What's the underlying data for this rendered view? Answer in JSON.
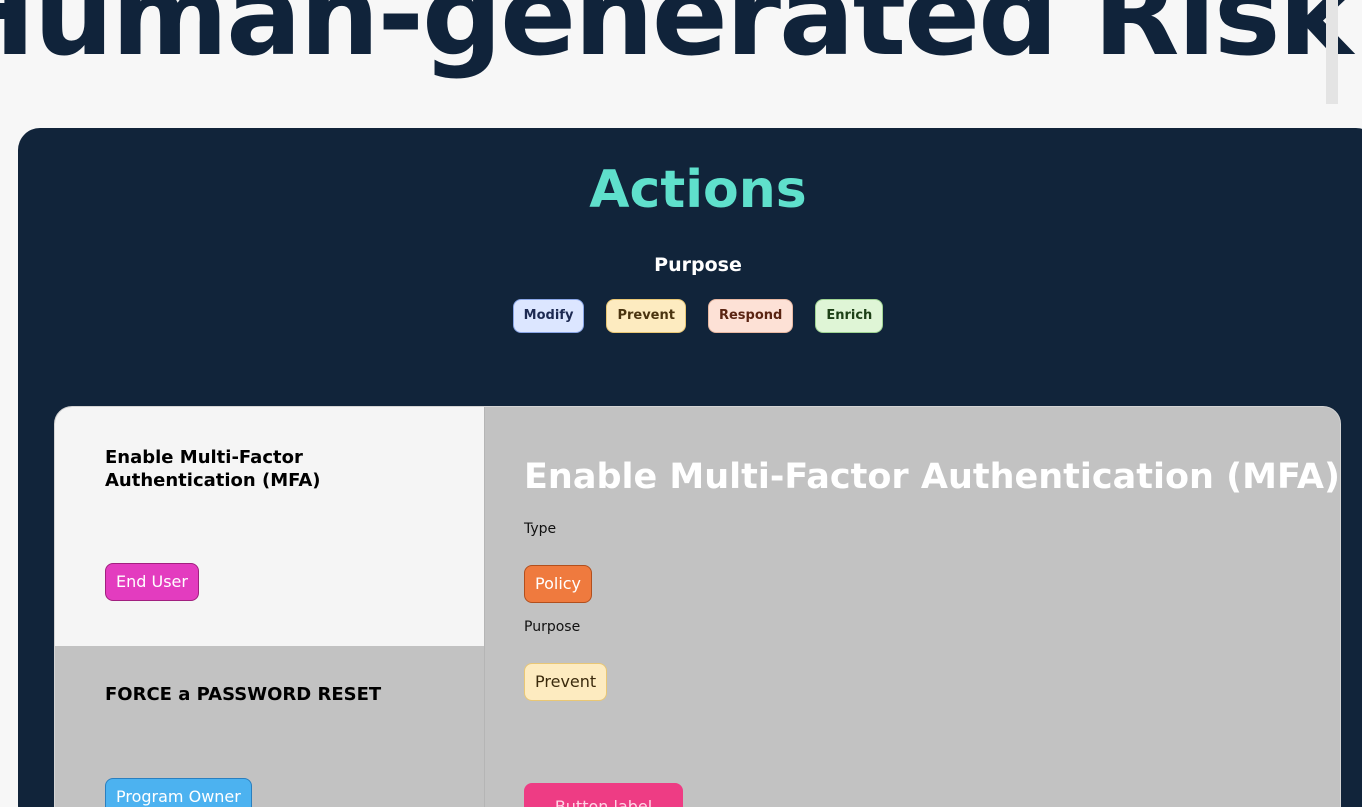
{
  "hero": {
    "text": "Human-generated Risk"
  },
  "section": {
    "title": "Actions",
    "purpose_heading": "Purpose"
  },
  "legend": [
    {
      "label": "Modify",
      "color": "#dce6ff"
    },
    {
      "label": "Prevent",
      "color": "#fdebc0"
    },
    {
      "label": "Respond",
      "color": "#fde1d6"
    },
    {
      "label": "Enrich",
      "color": "#dff5d6"
    }
  ],
  "list": [
    {
      "title": "Enable Multi-Factor Authentication (MFA)",
      "role": "End User",
      "role_color": "#e33cbf"
    },
    {
      "title": "FORCE a PASSWORD RESET",
      "role": "Program Owner",
      "role_color": "#4cb2f0"
    }
  ],
  "detail": {
    "title": "Enable Multi-Factor Authentication (MFA)",
    "type_label": "Type",
    "type_value": "Policy",
    "purpose_label": "Purpose",
    "purpose_value": "Prevent",
    "button_label": "Button label"
  }
}
